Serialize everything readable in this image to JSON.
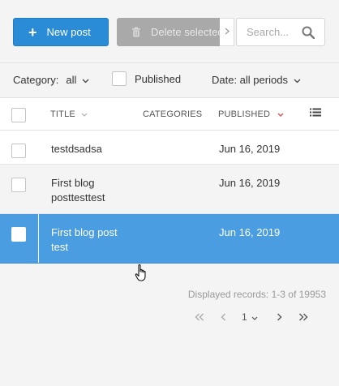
{
  "toolbar": {
    "new_post_label": "New post",
    "delete_label": "Delete selected",
    "search_placeholder": "Search..."
  },
  "filters": {
    "category_label": "Category:",
    "category_value": "all",
    "published_label": "Published",
    "date_label": "Date: all periods"
  },
  "table": {
    "columns": {
      "title": "TITLE",
      "categories": "CATEGORIES",
      "published": "PUBLISHED"
    },
    "rows": [
      {
        "title": "testdsadsa",
        "published": "Jun 16, 2019"
      },
      {
        "title": "First blog posttesttest",
        "published": "Jun 16, 2019"
      },
      {
        "title": "First blog post test",
        "published": "Jun 16, 2019"
      }
    ]
  },
  "footer": {
    "records": "Displayed records: 1-3 of 19953",
    "current_page": "1"
  },
  "colors": {
    "primary": "#2a8bd6",
    "selected_row": "#4a9de0",
    "sort_accent": "#d9534f"
  }
}
